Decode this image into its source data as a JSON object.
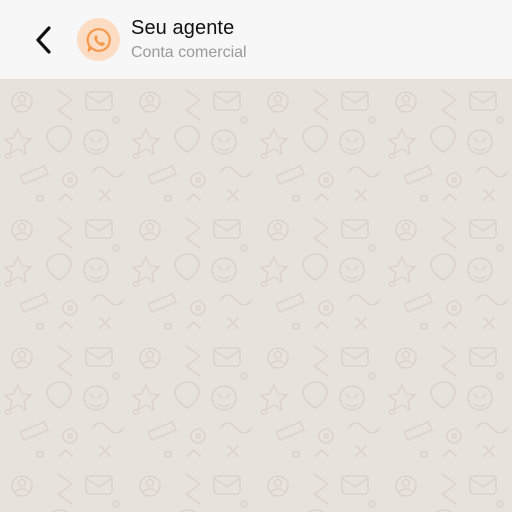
{
  "header": {
    "back_icon": "chevron-left-icon",
    "avatar_icon": "whatsapp-icon",
    "contact_name": "Seu agente",
    "contact_subtitle": "Conta comercial"
  },
  "colors": {
    "header_bg": "#f7f7f7",
    "chat_bg": "#e8e2dd",
    "avatar_bg": "#fcdcc3",
    "avatar_accent": "#f59a4c",
    "name_text": "#111111",
    "subtitle_text": "#9a9a9a",
    "doodle": "#d7cfc8"
  }
}
